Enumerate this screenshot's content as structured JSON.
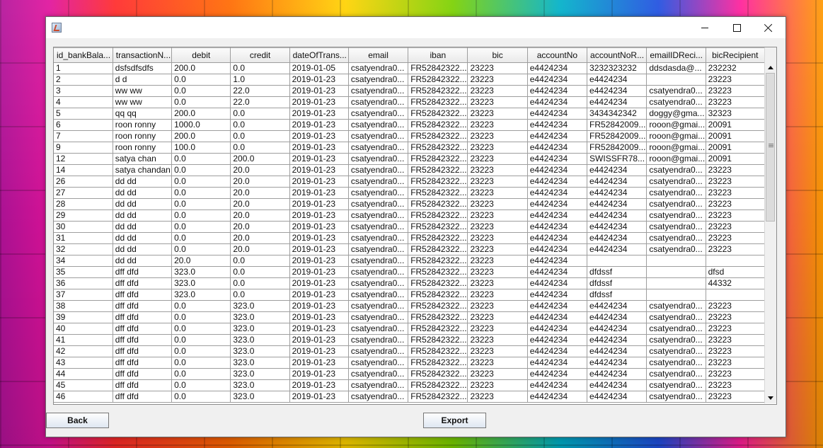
{
  "window": {
    "title": "",
    "buttons": {
      "minimize": "—",
      "maximize": "□",
      "close": "✕"
    }
  },
  "table": {
    "columns": [
      "id_bankBala...",
      "transactionN...",
      "debit",
      "credit",
      "dateOfTrans...",
      "email",
      "iban",
      "bic",
      "accountNo",
      "accountNoR...",
      "emailIDReci...",
      "bicRecipient"
    ],
    "rows": [
      [
        "1",
        "dsfsdfsdfs",
        "200.0",
        "0.0",
        "2019-01-05",
        "csatyendra0...",
        "FR52842322...",
        "23223",
        "e4424234",
        "3232323232",
        "ddsdasda@...",
        "232232"
      ],
      [
        "2",
        "d d",
        "0.0",
        "1.0",
        "2019-01-23",
        "csatyendra0...",
        "FR52842322...",
        "23223",
        "e4424234",
        "e4424234",
        "",
        "23223"
      ],
      [
        "3",
        "ww ww",
        "0.0",
        "22.0",
        "2019-01-23",
        "csatyendra0...",
        "FR52842322...",
        "23223",
        "e4424234",
        "e4424234",
        "csatyendra0...",
        "23223"
      ],
      [
        "4",
        "ww ww",
        "0.0",
        "22.0",
        "2019-01-23",
        "csatyendra0...",
        "FR52842322...",
        "23223",
        "e4424234",
        "e4424234",
        "csatyendra0...",
        "23223"
      ],
      [
        "5",
        "qq qq",
        "200.0",
        "0.0",
        "2019-01-23",
        "csatyendra0...",
        "FR52842322...",
        "23223",
        "e4424234",
        "3434342342",
        "doggy@gma...",
        "32323"
      ],
      [
        "6",
        "roon ronny",
        "1000.0",
        "0.0",
        "2019-01-23",
        "csatyendra0...",
        "FR52842322...",
        "23223",
        "e4424234",
        "FR52842009...",
        "rooon@gmai...",
        "20091"
      ],
      [
        "7",
        "roon ronny",
        "200.0",
        "0.0",
        "2019-01-23",
        "csatyendra0...",
        "FR52842322...",
        "23223",
        "e4424234",
        "FR52842009...",
        "rooon@gmai...",
        "20091"
      ],
      [
        "9",
        "roon ronny",
        "100.0",
        "0.0",
        "2019-01-23",
        "csatyendra0...",
        "FR52842322...",
        "23223",
        "e4424234",
        "FR52842009...",
        "rooon@gmai...",
        "20091"
      ],
      [
        "12",
        "satya chan",
        "0.0",
        "200.0",
        "2019-01-23",
        "csatyendra0...",
        "FR52842322...",
        "23223",
        "e4424234",
        "SWISSFR78...",
        "rooon@gmai...",
        "20091"
      ],
      [
        "14",
        "satya chandan",
        "0.0",
        "20.0",
        "2019-01-23",
        "csatyendra0...",
        "FR52842322...",
        "23223",
        "e4424234",
        "e4424234",
        "csatyendra0...",
        "23223"
      ],
      [
        "26",
        "dd dd",
        "0.0",
        "20.0",
        "2019-01-23",
        "csatyendra0...",
        "FR52842322...",
        "23223",
        "e4424234",
        "e4424234",
        "csatyendra0...",
        "23223"
      ],
      [
        "27",
        "dd dd",
        "0.0",
        "20.0",
        "2019-01-23",
        "csatyendra0...",
        "FR52842322...",
        "23223",
        "e4424234",
        "e4424234",
        "csatyendra0...",
        "23223"
      ],
      [
        "28",
        "dd dd",
        "0.0",
        "20.0",
        "2019-01-23",
        "csatyendra0...",
        "FR52842322...",
        "23223",
        "e4424234",
        "e4424234",
        "csatyendra0...",
        "23223"
      ],
      [
        "29",
        "dd dd",
        "0.0",
        "20.0",
        "2019-01-23",
        "csatyendra0...",
        "FR52842322...",
        "23223",
        "e4424234",
        "e4424234",
        "csatyendra0...",
        "23223"
      ],
      [
        "30",
        "dd dd",
        "0.0",
        "20.0",
        "2019-01-23",
        "csatyendra0...",
        "FR52842322...",
        "23223",
        "e4424234",
        "e4424234",
        "csatyendra0...",
        "23223"
      ],
      [
        "31",
        "dd dd",
        "0.0",
        "20.0",
        "2019-01-23",
        "csatyendra0...",
        "FR52842322...",
        "23223",
        "e4424234",
        "e4424234",
        "csatyendra0...",
        "23223"
      ],
      [
        "32",
        "dd dd",
        "0.0",
        "20.0",
        "2019-01-23",
        "csatyendra0...",
        "FR52842322...",
        "23223",
        "e4424234",
        "e4424234",
        "csatyendra0...",
        "23223"
      ],
      [
        "34",
        "dd dd",
        "20.0",
        "0.0",
        "2019-01-23",
        "csatyendra0...",
        "FR52842322...",
        "23223",
        "e4424234",
        "",
        "",
        ""
      ],
      [
        "35",
        "dff dfd",
        "323.0",
        "0.0",
        "2019-01-23",
        "csatyendra0...",
        "FR52842322...",
        "23223",
        "e4424234",
        "dfdssf",
        "",
        "dfsd"
      ],
      [
        "36",
        "dff dfd",
        "323.0",
        "0.0",
        "2019-01-23",
        "csatyendra0...",
        "FR52842322...",
        "23223",
        "e4424234",
        "dfdssf",
        "",
        "44332"
      ],
      [
        "37",
        "dff dfd",
        "323.0",
        "0.0",
        "2019-01-23",
        "csatyendra0...",
        "FR52842322...",
        "23223",
        "e4424234",
        "dfdssf",
        "",
        ""
      ],
      [
        "38",
        "dff dfd",
        "0.0",
        "323.0",
        "2019-01-23",
        "csatyendra0...",
        "FR52842322...",
        "23223",
        "e4424234",
        "e4424234",
        "csatyendra0...",
        "23223"
      ],
      [
        "39",
        "dff dfd",
        "0.0",
        "323.0",
        "2019-01-23",
        "csatyendra0...",
        "FR52842322...",
        "23223",
        "e4424234",
        "e4424234",
        "csatyendra0...",
        "23223"
      ],
      [
        "40",
        "dff dfd",
        "0.0",
        "323.0",
        "2019-01-23",
        "csatyendra0...",
        "FR52842322...",
        "23223",
        "e4424234",
        "e4424234",
        "csatyendra0...",
        "23223"
      ],
      [
        "41",
        "dff dfd",
        "0.0",
        "323.0",
        "2019-01-23",
        "csatyendra0...",
        "FR52842322...",
        "23223",
        "e4424234",
        "e4424234",
        "csatyendra0...",
        "23223"
      ],
      [
        "42",
        "dff dfd",
        "0.0",
        "323.0",
        "2019-01-23",
        "csatyendra0...",
        "FR52842322...",
        "23223",
        "e4424234",
        "e4424234",
        "csatyendra0...",
        "23223"
      ],
      [
        "43",
        "dff dfd",
        "0.0",
        "323.0",
        "2019-01-23",
        "csatyendra0...",
        "FR52842322...",
        "23223",
        "e4424234",
        "e4424234",
        "csatyendra0...",
        "23223"
      ],
      [
        "44",
        "dff dfd",
        "0.0",
        "323.0",
        "2019-01-23",
        "csatyendra0...",
        "FR52842322...",
        "23223",
        "e4424234",
        "e4424234",
        "csatyendra0...",
        "23223"
      ],
      [
        "45",
        "dff dfd",
        "0.0",
        "323.0",
        "2019-01-23",
        "csatyendra0...",
        "FR52842322...",
        "23223",
        "e4424234",
        "e4424234",
        "csatyendra0...",
        "23223"
      ],
      [
        "46",
        "dff dfd",
        "0.0",
        "323.0",
        "2019-01-23",
        "csatyendra0...",
        "FR52842322...",
        "23223",
        "e4424234",
        "e4424234",
        "csatyendra0...",
        "23223"
      ]
    ]
  },
  "buttons": {
    "back": "Back",
    "export": "Export"
  },
  "icons": {
    "app": "java-app-icon",
    "scroll_up": "scroll-up-arrow-icon",
    "scroll_down": "scroll-down-arrow-icon"
  }
}
